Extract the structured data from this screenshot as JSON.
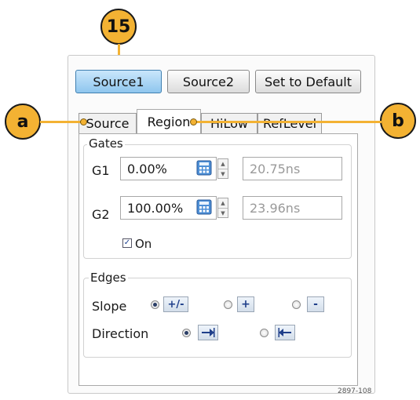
{
  "callouts": {
    "main": "15",
    "left": "a",
    "right": "b"
  },
  "buttons": {
    "source1": "Source1",
    "source2": "Source2",
    "set_default": "Set to Default"
  },
  "tabs": [
    {
      "label": "Source"
    },
    {
      "label": "Region",
      "selected": true
    },
    {
      "label": "HiLow"
    },
    {
      "label": "RefLevel"
    }
  ],
  "gates": {
    "title": "Gates",
    "g1": {
      "label": "G1",
      "value": "0.00%",
      "time": "20.75ns"
    },
    "g2": {
      "label": "G2",
      "value": "100.00%",
      "time": "23.96ns"
    },
    "on_label": "On",
    "on_checked": true
  },
  "edges": {
    "title": "Edges",
    "slope": {
      "label": "Slope",
      "options": [
        "+/-",
        "+",
        "-"
      ],
      "selected": "+/-"
    },
    "direction": {
      "label": "Direction",
      "selected": "forward"
    }
  },
  "figure_id": "2897-108",
  "colors": {
    "callout": "#f3b233",
    "selected_button": "#8fc6ee",
    "arrow": "#1f3f8a"
  },
  "icons": {
    "calculator": "calculator-icon",
    "spinner": "spinner-icon"
  }
}
